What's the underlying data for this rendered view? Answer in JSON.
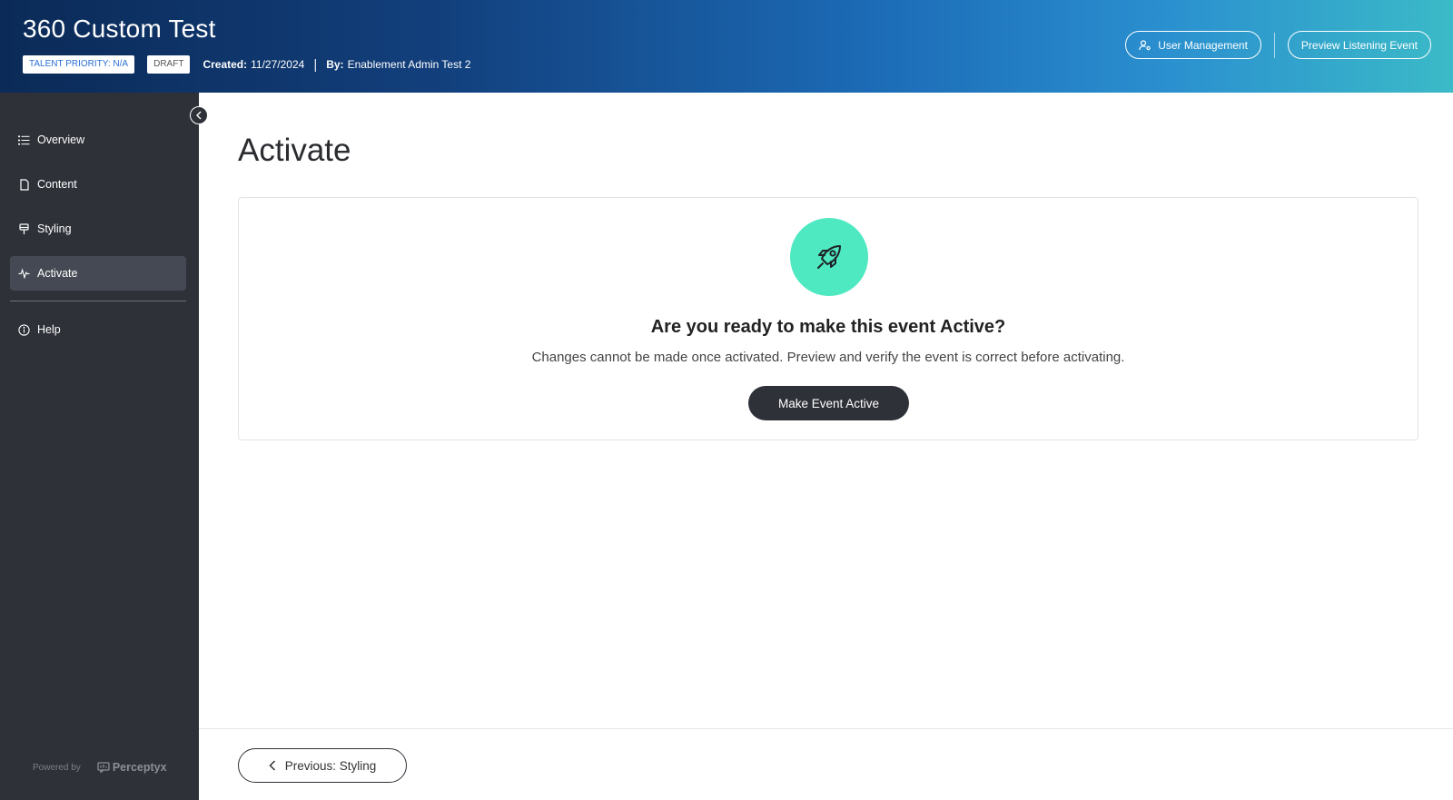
{
  "header": {
    "title": "360 Custom Test",
    "talent_priority_badge": "TALENT PRIORITY: N/A",
    "status_badge": "DRAFT",
    "created_label": "Created:",
    "created_value": "11/27/2024",
    "separator": "|",
    "by_label": "By:",
    "by_value": "Enablement Admin Test 2",
    "user_management_label": "User Management",
    "preview_label": "Preview Listening Event"
  },
  "sidebar": {
    "items": [
      {
        "label": "Overview",
        "icon": "list-icon"
      },
      {
        "label": "Content",
        "icon": "document-icon"
      },
      {
        "label": "Styling",
        "icon": "paint-brush-icon"
      },
      {
        "label": "Activate",
        "icon": "pulse-icon",
        "active": true
      },
      {
        "label": "Help",
        "icon": "info-icon"
      }
    ],
    "powered_by": "Powered by",
    "brand": "Perceptyx"
  },
  "main": {
    "page_title": "Activate",
    "card": {
      "icon": "rocket-icon",
      "heading": "Are you ready to make this event Active?",
      "description": "Changes cannot be made once activated. Preview and verify the event is correct before activating.",
      "button_label": "Make Event Active"
    },
    "previous_button_label": "Previous: Styling"
  },
  "colors": {
    "sidebar_bg": "#2e3138",
    "accent_mint": "#4ee8c1",
    "header_gradient_start": "#0b2a57",
    "header_gradient_end": "#3bbac8"
  }
}
